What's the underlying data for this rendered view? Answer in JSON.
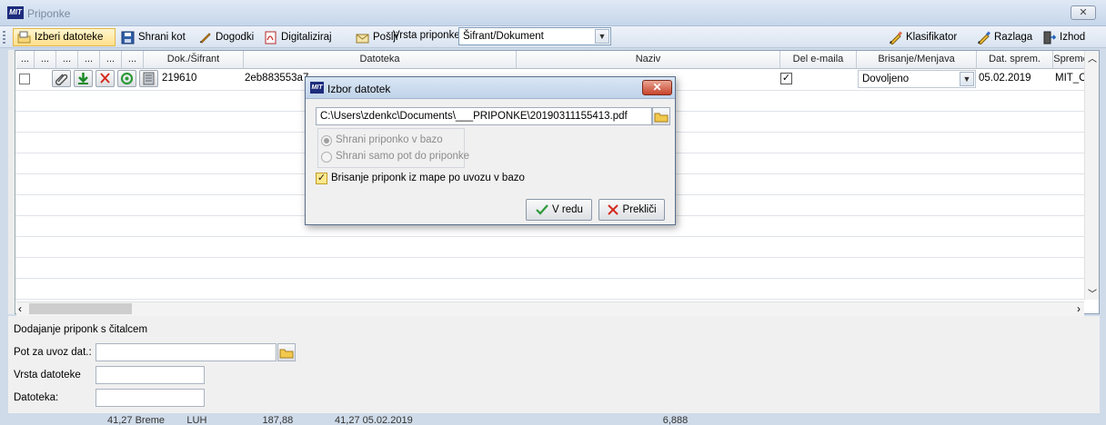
{
  "window": {
    "title": "Priponke",
    "logo_text": "MIT",
    "close_glyph": "✕"
  },
  "toolbar": {
    "izberi": "Izberi datoteke",
    "shrani_kot": "Shrani kot",
    "dogodki": "Dogodki",
    "digitaliziraj": "Digitaliziraj",
    "poslji": "Pošlji",
    "vrsta_label": "Vrsta priponke:",
    "vrsta_value": "Šifrant/Dokument",
    "klasifikator": "Klasifikator",
    "razlaga": "Razlaga",
    "izhod": "Izhod"
  },
  "grid": {
    "columns": [
      "...",
      "...",
      "...",
      "...",
      "...",
      "...",
      "Dok./Šifrant",
      "Datoteka",
      "Naziv",
      "Del e-maila",
      "Brisanje/Menjava",
      "Dat. sprem.",
      "Spreme"
    ],
    "row": {
      "dok": "219610",
      "datoteka": "2eb883553a7",
      "brisanje": "Dovoljeno",
      "dat_sprem": "05.02.2019",
      "sprem": "MIT_O"
    }
  },
  "bottom": {
    "section_title": "Dodajanje priponk s čitalcem",
    "pot_label": "Pot za uvoz dat.:",
    "vrsta_label": "Vrsta datoteke",
    "datoteka_label": "Datoteka:",
    "pot_value": "",
    "vrsta_value": "",
    "datoteka_value": ""
  },
  "background_row": "41,27 Breme        LUH                    187,88               41,27 05.02.2019                                                                                          6,888",
  "dialog": {
    "title": "Izbor datotek",
    "logo_text": "MIT",
    "close_glyph": "✕",
    "path": "C:\\Users\\zdenkc\\Documents\\___PRIPONKE\\20190311155413.pdf",
    "radio1": "Shrani priponko v bazo",
    "radio2": "Shrani samo pot do priponke",
    "checkbox_label": "Brisanje priponk iz mape po uvozu v bazo",
    "ok_label": "V redu",
    "cancel_label": "Prekliči"
  },
  "colors": {
    "accent_active": "#ffe08a",
    "titlebar": "#c6d6ea",
    "close_red": "#c8432a"
  }
}
